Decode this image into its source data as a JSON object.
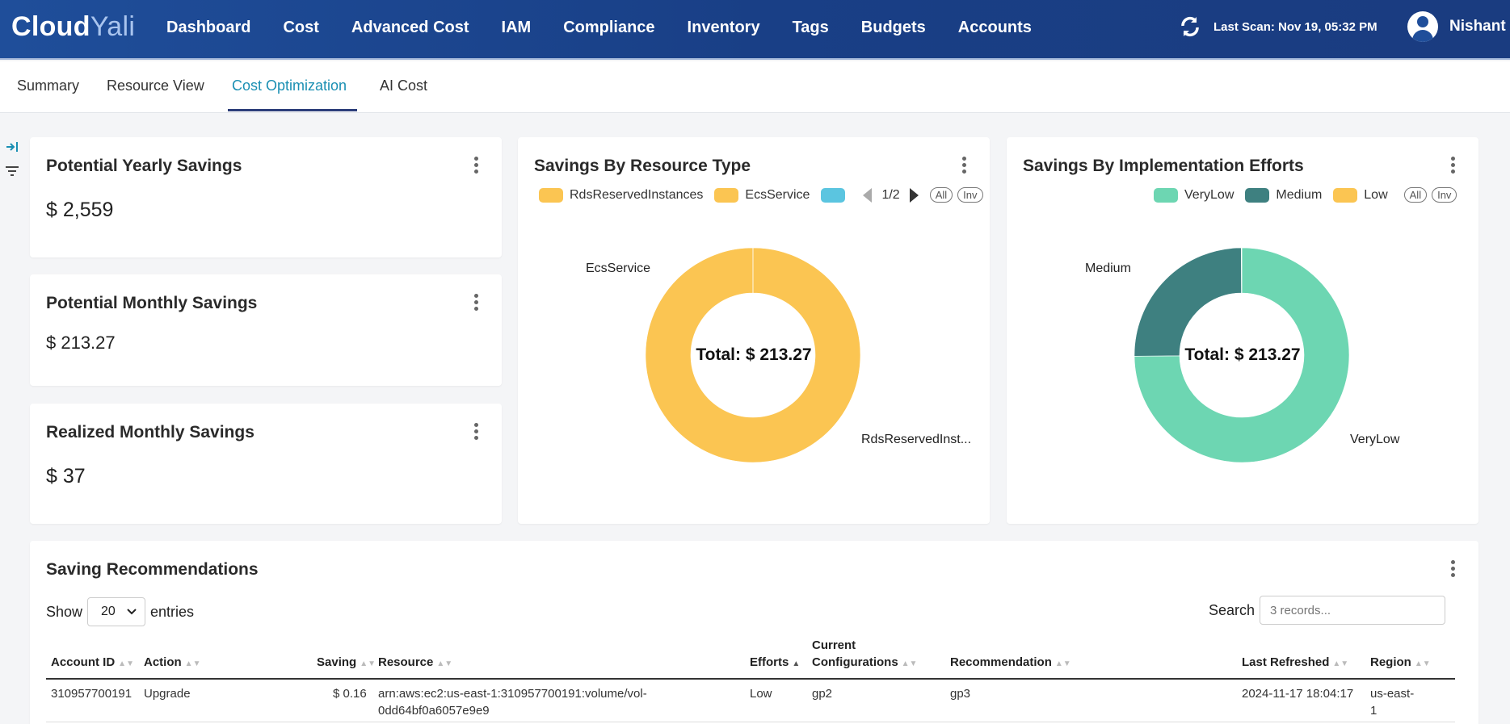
{
  "app": {
    "logo_main": "Cloud",
    "logo_accent": "Yali",
    "nav": [
      "Dashboard",
      "Cost",
      "Advanced Cost",
      "IAM",
      "Compliance",
      "Inventory",
      "Tags",
      "Budgets",
      "Accounts"
    ],
    "last_scan": "Last Scan: Nov 19, 05:32 PM",
    "user_name": "Nishant"
  },
  "subtabs": [
    "Summary",
    "Resource View",
    "Cost Optimization",
    "AI Cost"
  ],
  "active_subtab": "Cost Optimization",
  "cards": {
    "yearly": {
      "title": "Potential Yearly Savings",
      "value": "$ 2,559"
    },
    "monthly": {
      "title": "Potential Monthly Savings",
      "value": "$ 213.27"
    },
    "realized": {
      "title": "Realized Monthly Savings",
      "value": "$ 37"
    }
  },
  "resource_chart": {
    "title": "Savings By Resource Type",
    "legend": [
      "RdsReservedInstances",
      "EcsService"
    ],
    "page": "1/2",
    "all_label": "All",
    "inv_label": "Inv",
    "total": "Total: $ 213.27",
    "labels": [
      "EcsService",
      "RdsReservedInst..."
    ]
  },
  "effort_chart": {
    "title": "Savings By Implementation Efforts",
    "legend": [
      "VeryLow",
      "Medium",
      "Low"
    ],
    "all_label": "All",
    "inv_label": "Inv",
    "total": "Total: $ 213.27",
    "labels": [
      "Medium",
      "VeryLow"
    ]
  },
  "chart_data": [
    {
      "type": "pie",
      "title": "Savings By Resource Type",
      "categories": [
        "RdsReservedInstances",
        "EcsService"
      ],
      "values": [
        213.1,
        0.01
      ],
      "colors": [
        "#fbc552",
        "#fbc552"
      ]
    },
    {
      "type": "pie",
      "title": "Savings By Implementation Efforts",
      "categories": [
        "VeryLow",
        "Medium",
        "Low"
      ],
      "values": [
        159.6,
        53.5,
        0.16
      ],
      "colors": [
        "#6dd6b2",
        "#3e8080",
        "#fbc552"
      ]
    }
  ],
  "colors": {
    "rds": "#fbc552",
    "ecs": "#fbc552",
    "ecs_extra": "#5bc5e0",
    "verylow": "#6dd6b2",
    "medium": "#3e8080",
    "low": "#fbc552"
  },
  "table": {
    "title": "Saving Recommendations",
    "show_label": "Show",
    "entries_value": "20",
    "entries_label": "entries",
    "search_label": "Search",
    "search_placeholder": "3 records...",
    "columns": {
      "account_id": "Account ID",
      "action": "Action",
      "saving": "Saving",
      "resource": "Resource",
      "efforts": "Efforts",
      "current_line1": "Current",
      "current_line2": "Configurations",
      "recommendation": "Recommendation",
      "last_refreshed": "Last Refreshed",
      "region": "Region"
    },
    "rows": [
      {
        "account_id": "310957700191",
        "action": "Upgrade",
        "saving": "$ 0.16",
        "resource_line1": "arn:aws:ec2:us-east-1:310957700191:volume/vol-",
        "resource_line2": "0dd64bf0a6057e9e9",
        "efforts": "Low",
        "current": "gp2",
        "recommendation": "gp3",
        "last_refreshed": "2024-11-17 18:04:17",
        "region_line1": "us-east-",
        "region_line2": "1"
      }
    ]
  }
}
